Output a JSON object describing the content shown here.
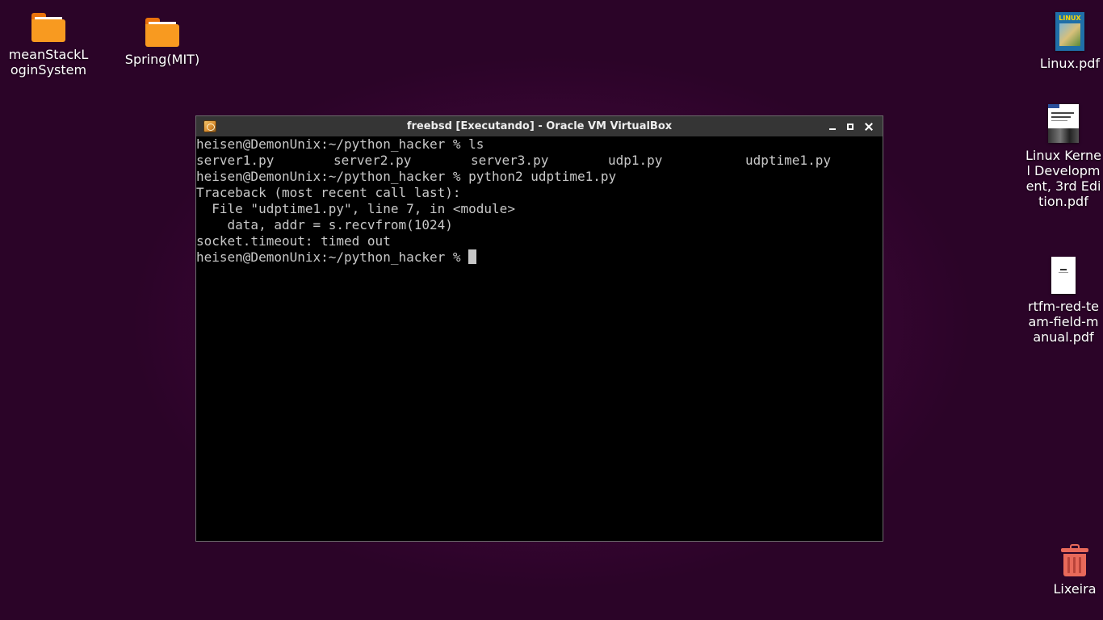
{
  "desktop": {
    "icons": [
      {
        "label": "meanStackLoginSystem",
        "type": "folder"
      },
      {
        "label": "Spring(MIT)",
        "type": "folder"
      },
      {
        "label": "Linux.pdf",
        "type": "pdf",
        "thumb_text": "LINUX"
      },
      {
        "label": "Linux Kernel Development, 3rd Edition.pdf",
        "type": "pdf"
      },
      {
        "label": "rtfm-red-team-field-manual.pdf",
        "type": "pdf"
      },
      {
        "label": "Lixeira",
        "type": "trash"
      }
    ],
    "background_color": "#3d0637"
  },
  "window": {
    "title": "freebsd [Executando] - Oracle VM VirtualBox",
    "app_icon": "virtualbox-icon",
    "buttons": [
      "minimize-icon",
      "maximize-icon",
      "close-icon"
    ]
  },
  "terminal": {
    "lines": [
      "heisen@DemonUnix:~/python_hacker % ls",
      "",
      "heisen@DemonUnix:~/python_hacker % python2 udptime1.py",
      "Traceback (most recent call last):",
      "  File \"udptime1.py\", line 7, in <module>",
      "    data, addr = s.recvfrom(1024)",
      "socket.timeout: timed out",
      "heisen@DemonUnix:~/python_hacker % "
    ],
    "ls_output": [
      "server1.py",
      "server2.py",
      "server3.py",
      "udp1.py",
      "udptime1.py"
    ],
    "text_color": "#c8c8c8",
    "background": "#000000"
  }
}
